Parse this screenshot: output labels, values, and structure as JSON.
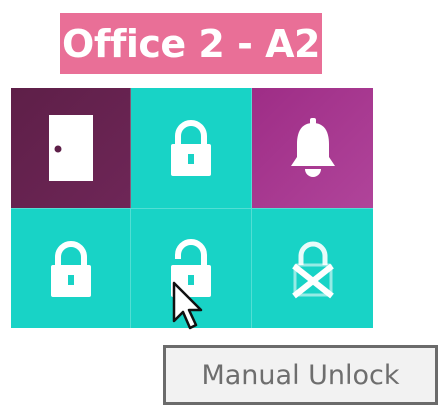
{
  "header": {
    "title": "Office 2 - A2"
  },
  "tiles": [
    {
      "icon": "door-icon",
      "color": "#5e1f48"
    },
    {
      "icon": "lock-closed-icon",
      "color": "#18d3c6"
    },
    {
      "icon": "bell-icon",
      "color": "#a7388f"
    },
    {
      "icon": "lock-closed-icon",
      "color": "#18d3c6"
    },
    {
      "icon": "lock-open-icon",
      "color": "#18d3c6"
    },
    {
      "icon": "lock-disabled-icon",
      "color": "#18d3c6"
    }
  ],
  "tooltip": {
    "text": "Manual Unlock"
  }
}
